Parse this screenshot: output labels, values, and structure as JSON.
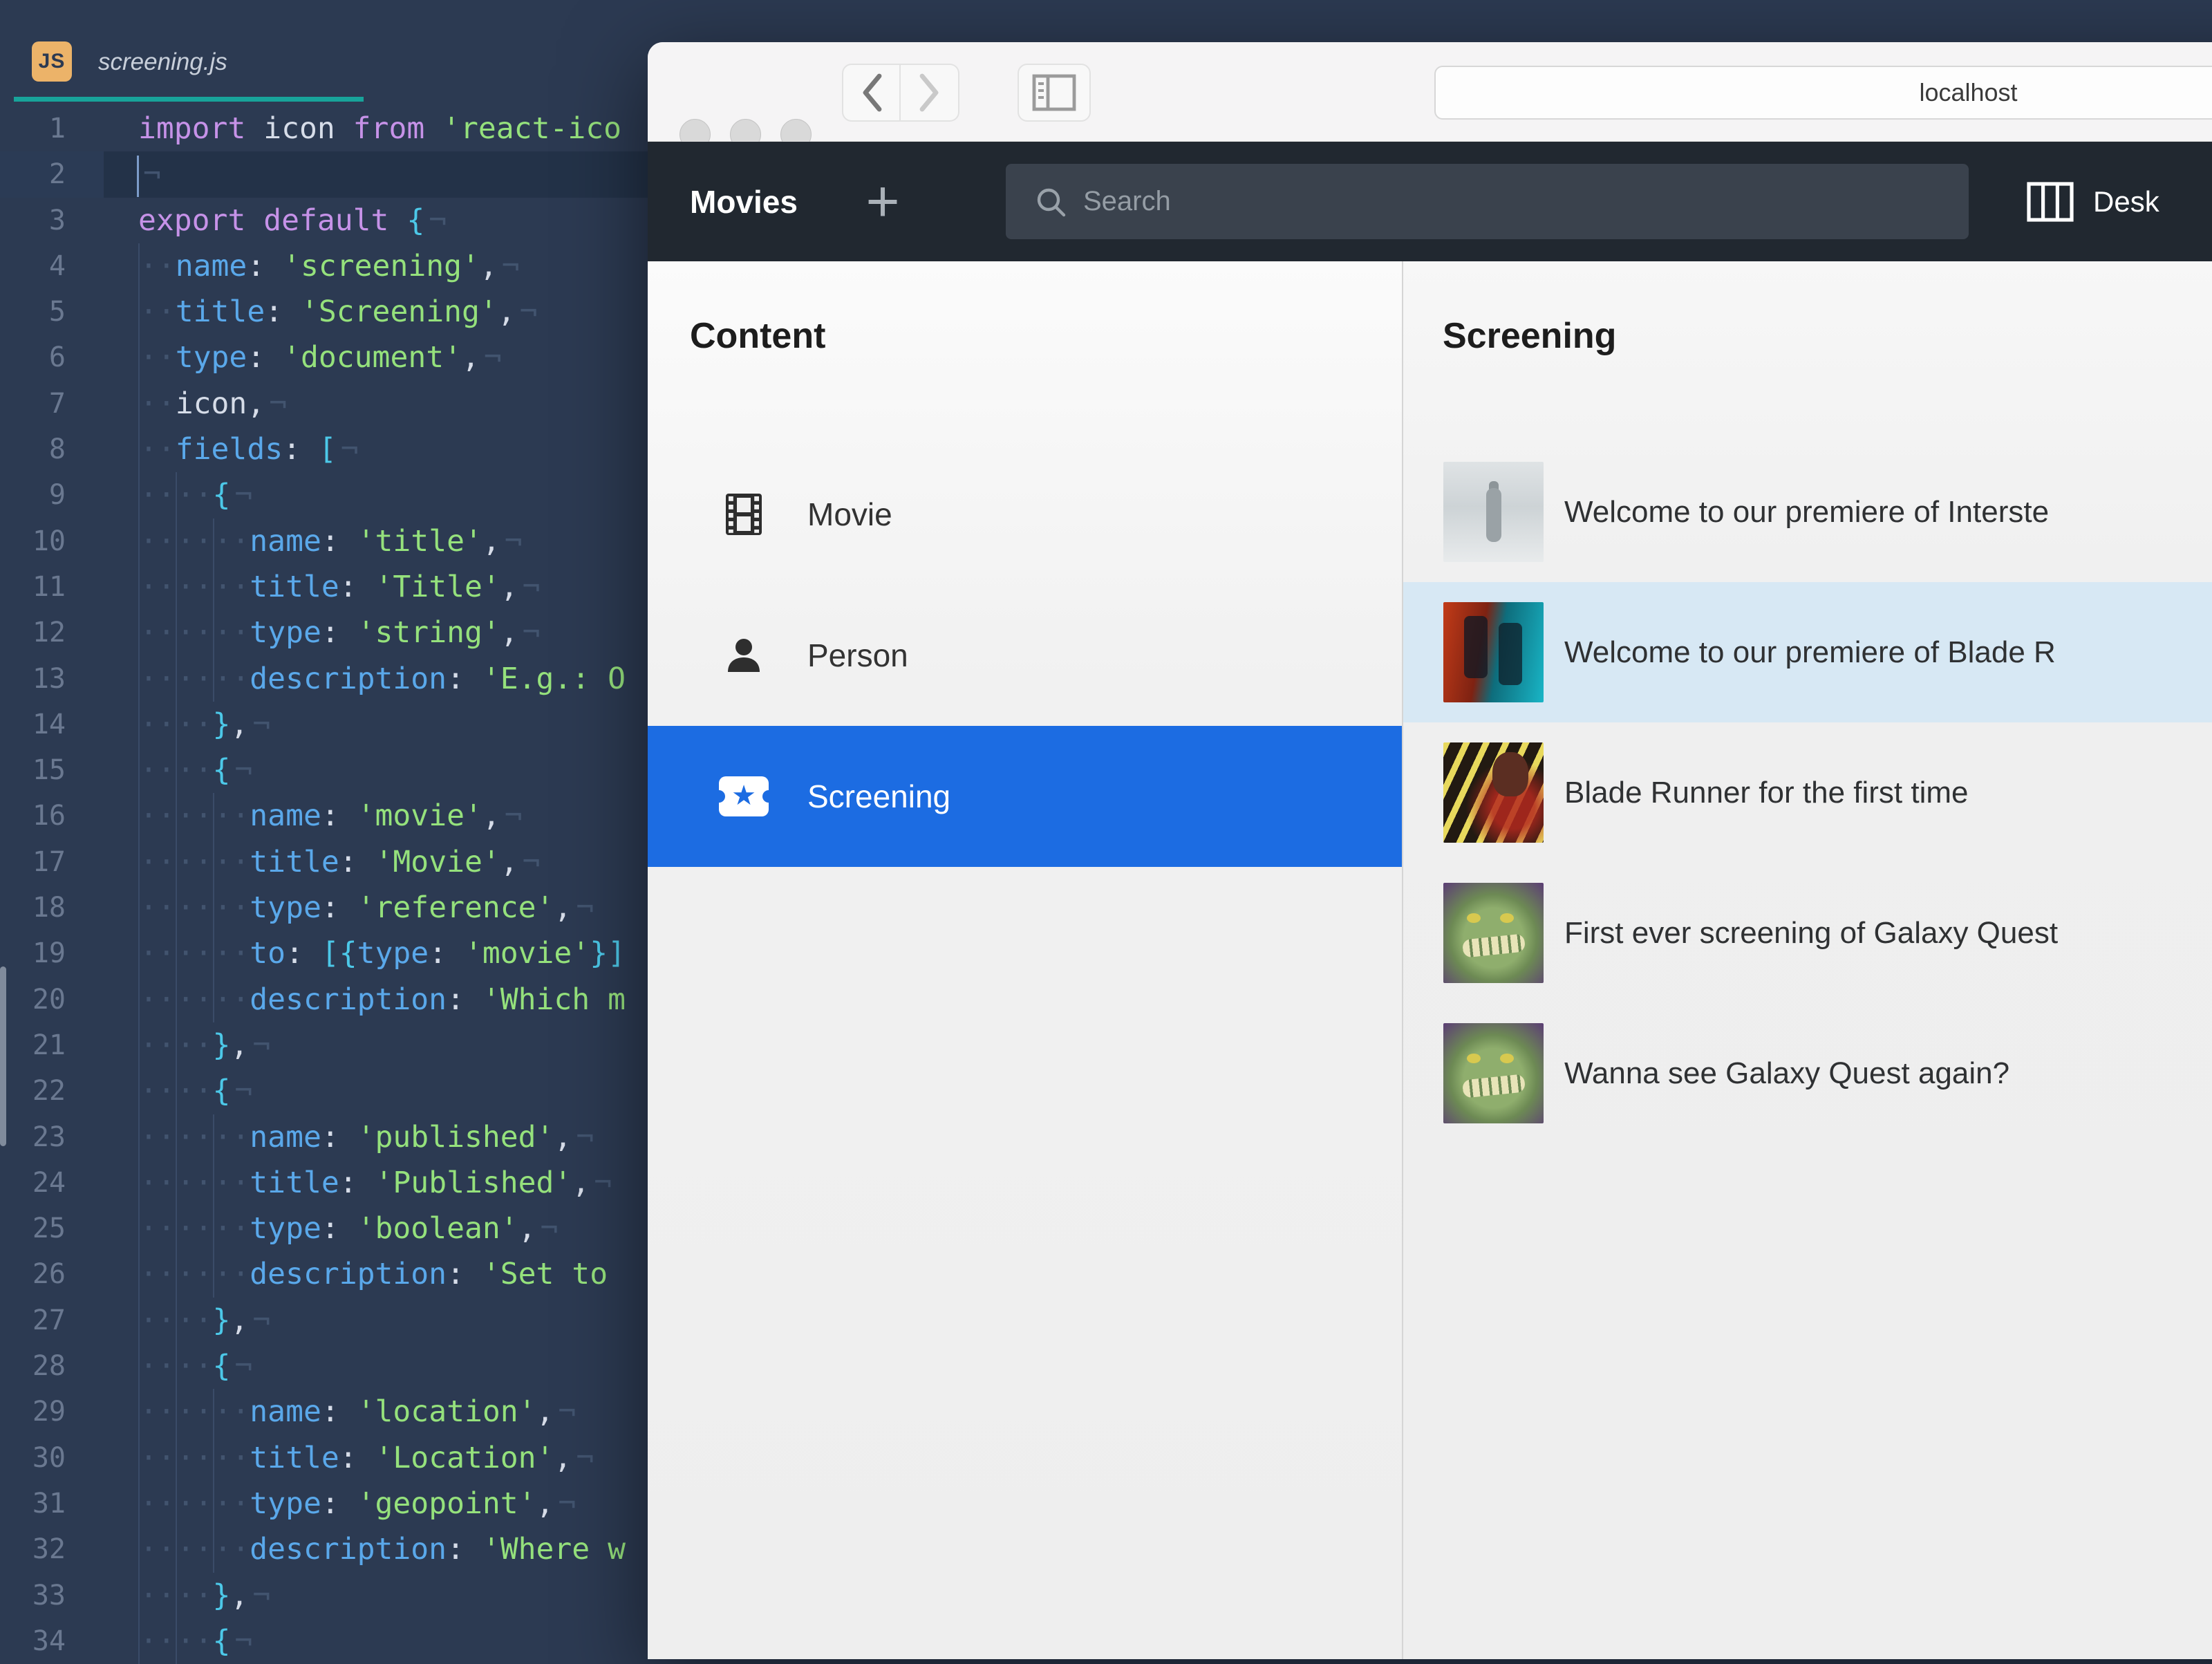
{
  "colors": {
    "editor_bg": "#2c3a52",
    "tab_accent": "#18a39a",
    "js_badge_bg": "#ecb369",
    "keyword": "#c692e8",
    "property": "#5aa8ea",
    "string": "#95e17c",
    "brace": "#4cc8e8",
    "header_bg": "#212830",
    "selected_blue": "#1c6ce2",
    "selected_row_light": "#d7e8f4"
  },
  "editor": {
    "tab": {
      "badge": "JS",
      "filename": "screening.js"
    },
    "lines": [
      {
        "n": 1,
        "indent": 0,
        "tokens": [
          [
            "kw",
            "import "
          ],
          [
            "id",
            "icon "
          ],
          [
            "kw",
            "from "
          ],
          [
            "st",
            "'react-ico"
          ]
        ],
        "eol": false
      },
      {
        "n": 2,
        "indent": 0,
        "tokens": [],
        "eol": true,
        "current": true
      },
      {
        "n": 3,
        "indent": 0,
        "tokens": [
          [
            "kw",
            "export default "
          ],
          [
            "br",
            "{"
          ]
        ],
        "eol": true
      },
      {
        "n": 4,
        "indent": 1,
        "tokens": [
          [
            "pr",
            "name"
          ],
          [
            "pu",
            ": "
          ],
          [
            "st",
            "'screening'"
          ],
          [
            "pu",
            ","
          ]
        ],
        "eol": true
      },
      {
        "n": 5,
        "indent": 1,
        "tokens": [
          [
            "pr",
            "title"
          ],
          [
            "pu",
            ": "
          ],
          [
            "st",
            "'Screening'"
          ],
          [
            "pu",
            ","
          ]
        ],
        "eol": true
      },
      {
        "n": 6,
        "indent": 1,
        "tokens": [
          [
            "pr",
            "type"
          ],
          [
            "pu",
            ": "
          ],
          [
            "st",
            "'document'"
          ],
          [
            "pu",
            ","
          ]
        ],
        "eol": true
      },
      {
        "n": 7,
        "indent": 1,
        "tokens": [
          [
            "id",
            "icon"
          ],
          [
            "pu",
            ","
          ]
        ],
        "eol": true
      },
      {
        "n": 8,
        "indent": 1,
        "tokens": [
          [
            "pr",
            "fields"
          ],
          [
            "pu",
            ": "
          ],
          [
            "br",
            "["
          ]
        ],
        "eol": true
      },
      {
        "n": 9,
        "indent": 2,
        "tokens": [
          [
            "br",
            "{"
          ]
        ],
        "eol": true
      },
      {
        "n": 10,
        "indent": 3,
        "tokens": [
          [
            "pr",
            "name"
          ],
          [
            "pu",
            ": "
          ],
          [
            "st",
            "'title'"
          ],
          [
            "pu",
            ","
          ]
        ],
        "eol": true
      },
      {
        "n": 11,
        "indent": 3,
        "tokens": [
          [
            "pr",
            "title"
          ],
          [
            "pu",
            ": "
          ],
          [
            "st",
            "'Title'"
          ],
          [
            "pu",
            ","
          ]
        ],
        "eol": true
      },
      {
        "n": 12,
        "indent": 3,
        "tokens": [
          [
            "pr",
            "type"
          ],
          [
            "pu",
            ": "
          ],
          [
            "st",
            "'string'"
          ],
          [
            "pu",
            ","
          ]
        ],
        "eol": true
      },
      {
        "n": 13,
        "indent": 3,
        "tokens": [
          [
            "pr",
            "description"
          ],
          [
            "pu",
            ": "
          ],
          [
            "st",
            "'E.g.: O"
          ]
        ],
        "eol": false
      },
      {
        "n": 14,
        "indent": 2,
        "tokens": [
          [
            "br",
            "}"
          ],
          [
            "pu",
            ","
          ]
        ],
        "eol": true
      },
      {
        "n": 15,
        "indent": 2,
        "tokens": [
          [
            "br",
            "{"
          ]
        ],
        "eol": true
      },
      {
        "n": 16,
        "indent": 3,
        "tokens": [
          [
            "pr",
            "name"
          ],
          [
            "pu",
            ": "
          ],
          [
            "st",
            "'movie'"
          ],
          [
            "pu",
            ","
          ]
        ],
        "eol": true
      },
      {
        "n": 17,
        "indent": 3,
        "tokens": [
          [
            "pr",
            "title"
          ],
          [
            "pu",
            ": "
          ],
          [
            "st",
            "'Movie'"
          ],
          [
            "pu",
            ","
          ]
        ],
        "eol": true
      },
      {
        "n": 18,
        "indent": 3,
        "tokens": [
          [
            "pr",
            "type"
          ],
          [
            "pu",
            ": "
          ],
          [
            "st",
            "'reference'"
          ],
          [
            "pu",
            ","
          ]
        ],
        "eol": true
      },
      {
        "n": 19,
        "indent": 3,
        "tokens": [
          [
            "pr",
            "to"
          ],
          [
            "pu",
            ": "
          ],
          [
            "br",
            "[{"
          ],
          [
            "pr",
            "type"
          ],
          [
            "pu",
            ": "
          ],
          [
            "st",
            "'movie'"
          ],
          [
            "br",
            "}]"
          ]
        ],
        "eol": false
      },
      {
        "n": 20,
        "indent": 3,
        "tokens": [
          [
            "pr",
            "description"
          ],
          [
            "pu",
            ": "
          ],
          [
            "st",
            "'Which m"
          ]
        ],
        "eol": false
      },
      {
        "n": 21,
        "indent": 2,
        "tokens": [
          [
            "br",
            "}"
          ],
          [
            "pu",
            ","
          ]
        ],
        "eol": true
      },
      {
        "n": 22,
        "indent": 2,
        "tokens": [
          [
            "br",
            "{"
          ]
        ],
        "eol": true
      },
      {
        "n": 23,
        "indent": 3,
        "tokens": [
          [
            "pr",
            "name"
          ],
          [
            "pu",
            ": "
          ],
          [
            "st",
            "'published'"
          ],
          [
            "pu",
            ","
          ]
        ],
        "eol": true
      },
      {
        "n": 24,
        "indent": 3,
        "tokens": [
          [
            "pr",
            "title"
          ],
          [
            "pu",
            ": "
          ],
          [
            "st",
            "'Published'"
          ],
          [
            "pu",
            ","
          ]
        ],
        "eol": true
      },
      {
        "n": 25,
        "indent": 3,
        "tokens": [
          [
            "pr",
            "type"
          ],
          [
            "pu",
            ": "
          ],
          [
            "st",
            "'boolean'"
          ],
          [
            "pu",
            ","
          ]
        ],
        "eol": true
      },
      {
        "n": 26,
        "indent": 3,
        "tokens": [
          [
            "pr",
            "description"
          ],
          [
            "pu",
            ": "
          ],
          [
            "st",
            "'Set to "
          ]
        ],
        "eol": false
      },
      {
        "n": 27,
        "indent": 2,
        "tokens": [
          [
            "br",
            "}"
          ],
          [
            "pu",
            ","
          ]
        ],
        "eol": true
      },
      {
        "n": 28,
        "indent": 2,
        "tokens": [
          [
            "br",
            "{"
          ]
        ],
        "eol": true
      },
      {
        "n": 29,
        "indent": 3,
        "tokens": [
          [
            "pr",
            "name"
          ],
          [
            "pu",
            ": "
          ],
          [
            "st",
            "'location'"
          ],
          [
            "pu",
            ","
          ]
        ],
        "eol": true
      },
      {
        "n": 30,
        "indent": 3,
        "tokens": [
          [
            "pr",
            "title"
          ],
          [
            "pu",
            ": "
          ],
          [
            "st",
            "'Location'"
          ],
          [
            "pu",
            ","
          ]
        ],
        "eol": true
      },
      {
        "n": 31,
        "indent": 3,
        "tokens": [
          [
            "pr",
            "type"
          ],
          [
            "pu",
            ": "
          ],
          [
            "st",
            "'geopoint'"
          ],
          [
            "pu",
            ","
          ]
        ],
        "eol": true
      },
      {
        "n": 32,
        "indent": 3,
        "tokens": [
          [
            "pr",
            "description"
          ],
          [
            "pu",
            ": "
          ],
          [
            "st",
            "'Where w"
          ]
        ],
        "eol": false
      },
      {
        "n": 33,
        "indent": 2,
        "tokens": [
          [
            "br",
            "}"
          ],
          [
            "pu",
            ","
          ]
        ],
        "eol": true
      },
      {
        "n": 34,
        "indent": 2,
        "tokens": [
          [
            "br",
            "{"
          ]
        ],
        "eol": true
      }
    ]
  },
  "browser": {
    "url": "localhost",
    "appbar": {
      "title": "Movies",
      "add_label": "+",
      "search_placeholder": "Search",
      "desk_label": "Desk"
    },
    "content_panel": {
      "heading": "Content",
      "items": [
        {
          "label": "Movie",
          "icon": "film-icon",
          "selected": false
        },
        {
          "label": "Person",
          "icon": "person-icon",
          "selected": false
        },
        {
          "label": "Screening",
          "icon": "ticket-icon",
          "selected": true
        }
      ]
    },
    "list_panel": {
      "heading": "Screening",
      "rows": [
        {
          "title": "Welcome to our premiere of Interste",
          "thumb": "interstellar-poster",
          "selected": false
        },
        {
          "title": "Welcome to our premiere of Blade R",
          "thumb": "blade-runner-2049-poster",
          "selected": true
        },
        {
          "title": "Blade Runner for the first time",
          "thumb": "blade-runner-poster",
          "selected": false
        },
        {
          "title": "First ever screening of Galaxy Quest",
          "thumb": "galaxy-quest-poster",
          "selected": false
        },
        {
          "title": "Wanna see Galaxy Quest again?",
          "thumb": "galaxy-quest-poster",
          "selected": false
        }
      ]
    }
  }
}
